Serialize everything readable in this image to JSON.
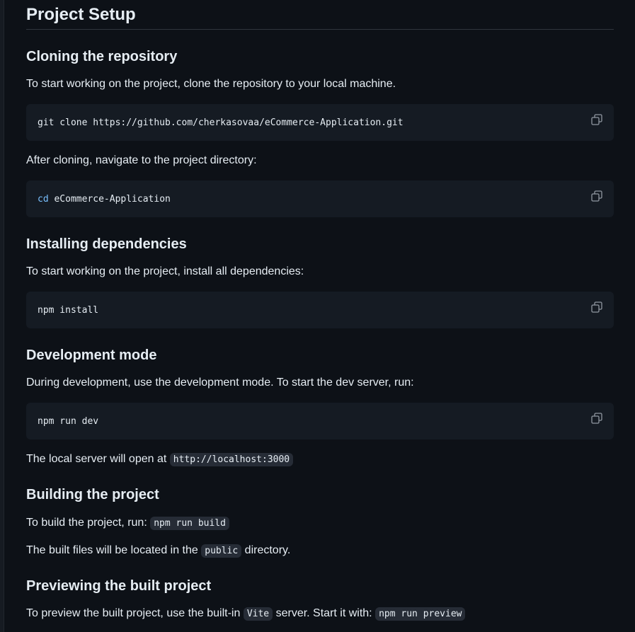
{
  "title": "Project Setup",
  "sections": {
    "cloning": {
      "heading": "Cloning the repository",
      "intro": "To start working on the project, clone the repository to your local machine.",
      "code": "git clone https://github.com/cherkasovaa/eCommerce-Application.git",
      "after": "After cloning, navigate to the project directory:",
      "cd_cmd": "cd",
      "cd_arg": " eCommerce-Application"
    },
    "installing": {
      "heading": "Installing dependencies",
      "intro": "To start working on the project, install all dependencies:",
      "code": "npm install"
    },
    "development": {
      "heading": "Development mode",
      "intro": "During development, use the development mode. To start the dev server, run:",
      "code": "npm run dev",
      "server_text": "The local server will open at ",
      "server_url": "http://localhost:3000"
    },
    "building": {
      "heading": "Building the project",
      "build_text": "To build the project, run: ",
      "build_cmd": "npm run build",
      "located_text_before": "The built files will be located in the ",
      "located_dir": "public",
      "located_text_after": " directory."
    },
    "previewing": {
      "heading": "Previewing the built project",
      "text_before": "To preview the built project, use the built-in ",
      "vite": "Vite",
      "text_middle": " server. Start it with: ",
      "preview_cmd": "npm run preview"
    }
  },
  "icons": {
    "copy": "copy-icon"
  },
  "colors": {
    "background": "#0d1117",
    "code_background": "#151b23",
    "text": "#e6edf3",
    "keyword": "#79c0ff"
  }
}
